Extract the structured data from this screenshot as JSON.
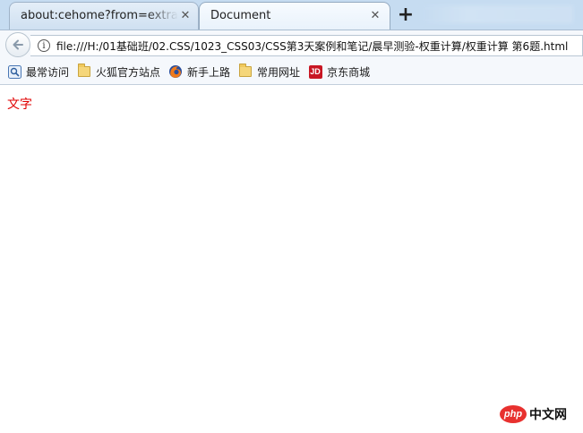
{
  "browser": {
    "tabs": [
      {
        "title": "about:cehome?from=extra_start",
        "active": false,
        "close_glyph": "✕"
      },
      {
        "title": "Document",
        "active": true,
        "close_glyph": "✕"
      }
    ],
    "new_tab_glyph": "+",
    "address_bar": {
      "url": "file:///H:/01基础班/02.CSS/1023_CSS03/CSS第3天案例和笔记/晨早测验-权重计算/权重计算 第6题.html",
      "info_glyph": "i"
    },
    "bookmarks": [
      {
        "label": "最常访问",
        "icon": "most-visited-icon"
      },
      {
        "label": "火狐官方站点",
        "icon": "folder-icon"
      },
      {
        "label": "新手上路",
        "icon": "firefox-icon"
      },
      {
        "label": "常用网址",
        "icon": "folder-icon"
      },
      {
        "label": "京东商城",
        "icon": "jd-icon",
        "icon_text": "JD"
      }
    ]
  },
  "page": {
    "text": "文字",
    "text_color": "#e00000"
  },
  "watermark": {
    "logo_text": "php",
    "site": "中文网"
  },
  "colors": {
    "tabstrip": "#c6dcf1",
    "toolbar": "#f5f8fc",
    "jd_red": "#c81623",
    "php_red": "#e8312f"
  }
}
